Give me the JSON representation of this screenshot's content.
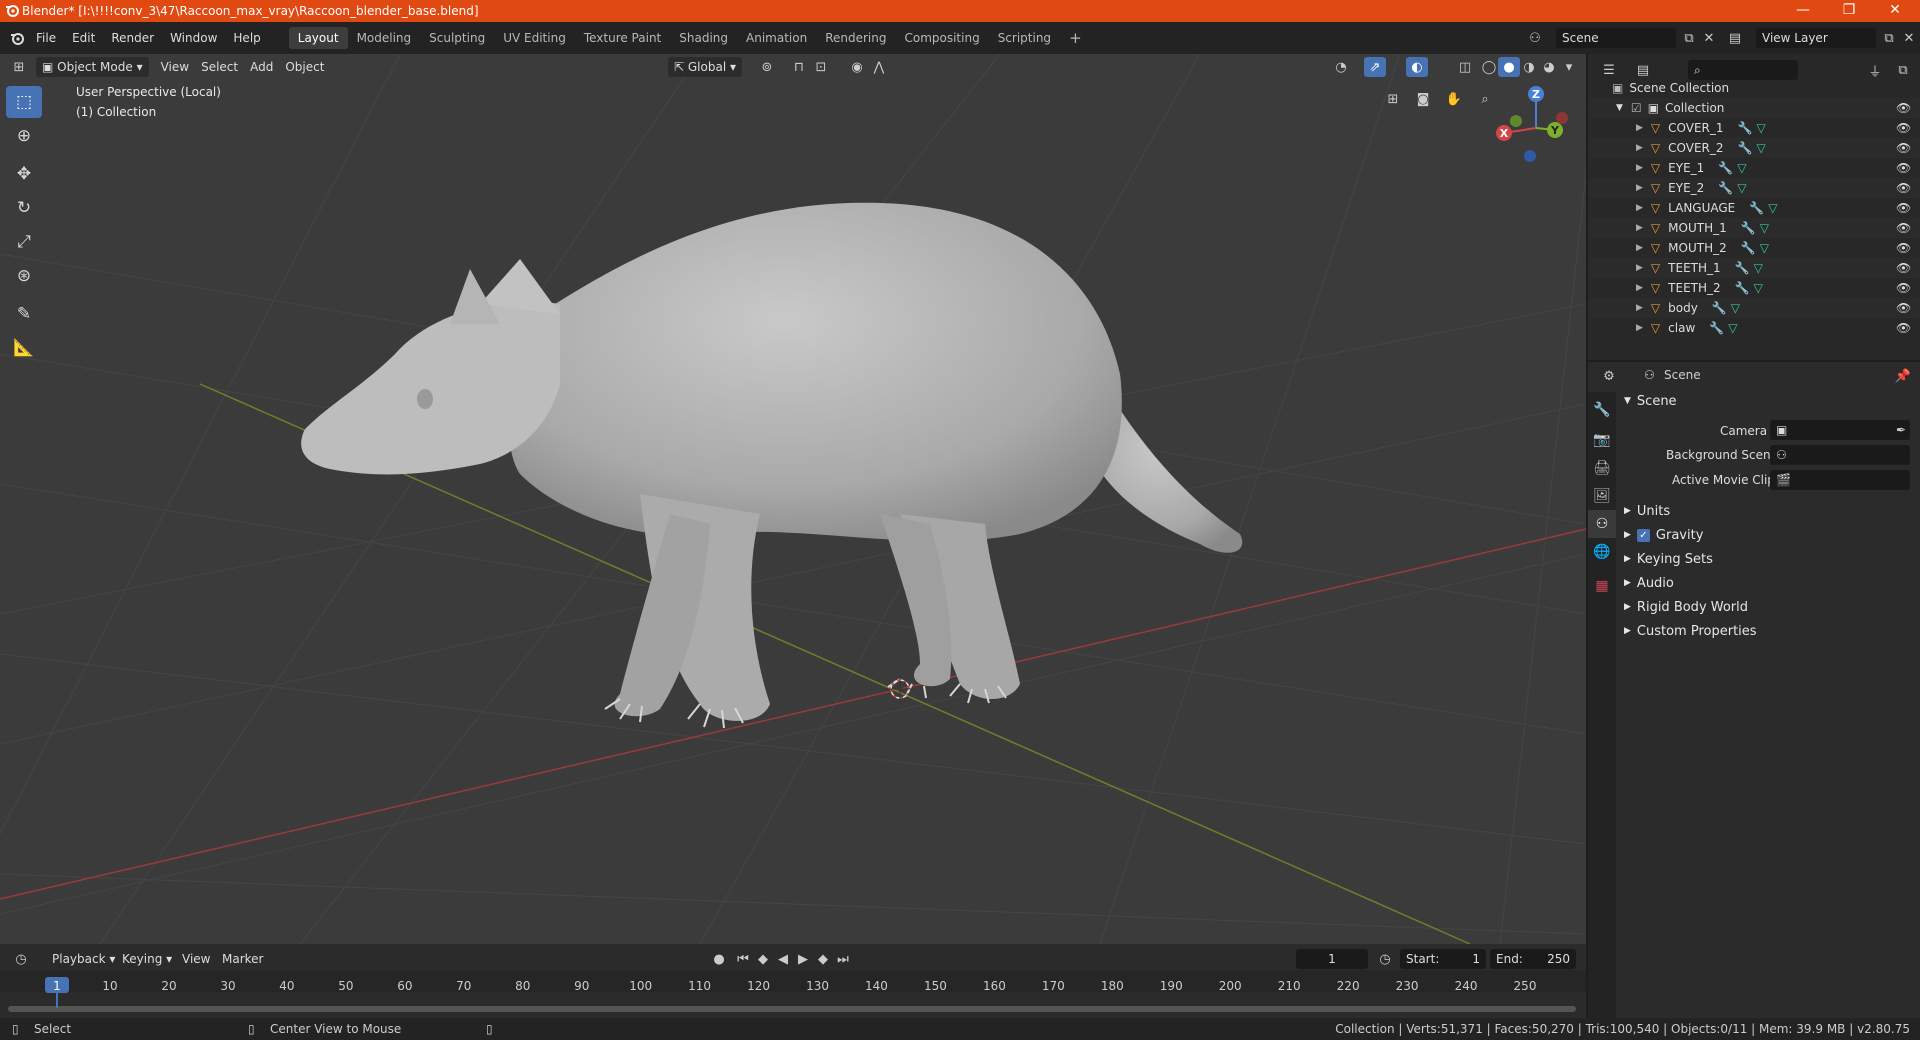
{
  "window": {
    "title": "Blender* [I:\\!!!!conv_3\\47\\Raccoon_max_vray\\Raccoon_blender_base.blend]",
    "minimize": "—",
    "maximize": "❐",
    "close": "✕"
  },
  "menu": [
    "File",
    "Edit",
    "Render",
    "Window",
    "Help"
  ],
  "workspaces": [
    {
      "label": "Layout",
      "active": true
    },
    {
      "label": "Modeling"
    },
    {
      "label": "Sculpting"
    },
    {
      "label": "UV Editing"
    },
    {
      "label": "Texture Paint"
    },
    {
      "label": "Shading"
    },
    {
      "label": "Animation"
    },
    {
      "label": "Rendering"
    },
    {
      "label": "Compositing"
    },
    {
      "label": "Scripting"
    }
  ],
  "add_workspace": "+",
  "scene_field": "Scene",
  "view_layer_field": "View Layer",
  "viewport": {
    "mode": "Object Mode",
    "menus": [
      "View",
      "Select",
      "Add",
      "Object"
    ],
    "transform_orientation": "Global",
    "info_line1": "User Perspective (Local)",
    "info_line2": "(1) Collection",
    "gizmo": {
      "x": "X",
      "y": "Y",
      "z": "Z"
    }
  },
  "outliner": {
    "root": "Scene Collection",
    "collection": "Collection",
    "items": [
      "COVER_1",
      "COVER_2",
      "EYE_1",
      "EYE_2",
      "LANGUAGE",
      "MOUTH_1",
      "MOUTH_2",
      "TEETH_1",
      "TEETH_2",
      "body",
      "claw"
    ]
  },
  "properties": {
    "context": "Scene",
    "section": "Scene",
    "camera_label": "Camera",
    "background_scene_label": "Background Scene",
    "active_movie_clip_label": "Active Movie Clip",
    "panels": [
      "Units",
      "Gravity",
      "Keying Sets",
      "Audio",
      "Rigid Body World",
      "Custom Properties"
    ]
  },
  "timeline": {
    "menus": [
      "Playback",
      "Keying",
      "View",
      "Marker"
    ],
    "current_frame": "1",
    "start_label": "Start:",
    "start": "1",
    "end_label": "End:",
    "end": "250",
    "ticks": [
      "1",
      "10",
      "20",
      "30",
      "40",
      "50",
      "60",
      "70",
      "80",
      "90",
      "100",
      "110",
      "120",
      "130",
      "140",
      "150",
      "160",
      "170",
      "180",
      "190",
      "200",
      "210",
      "220",
      "230",
      "240",
      "250"
    ]
  },
  "status": {
    "select": "Select",
    "center_view": "Center View to Mouse",
    "stats": "Collection | Verts:51,371 | Faces:50,270 | Tris:100,540 | Objects:0/11 | Mem: 39.9 MB | v2.80.75"
  }
}
